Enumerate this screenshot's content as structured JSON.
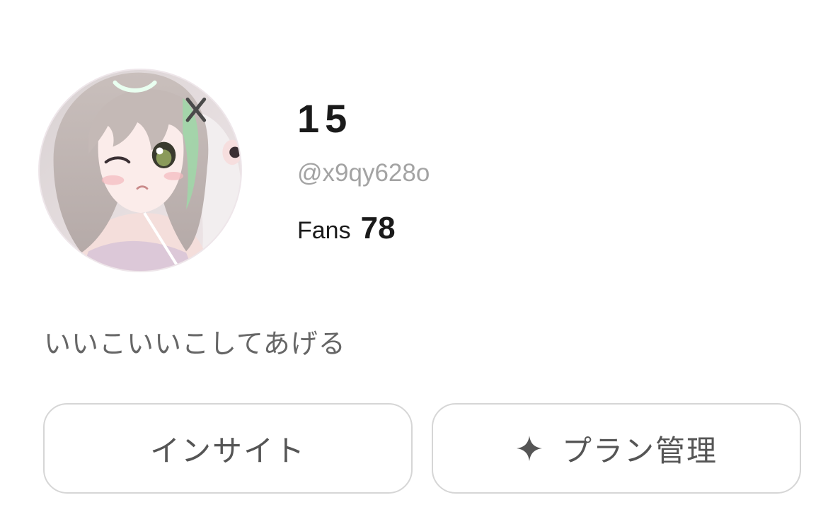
{
  "profile": {
    "display_name": "15",
    "handle": "@x9qy628o",
    "fans_label": "Fans",
    "fans_count": "78",
    "bio": "いいこいいこしてあげる"
  },
  "actions": {
    "insight_label": "インサイト",
    "plan_label": "プラン管理",
    "plan_icon": "sparkle-icon"
  },
  "colors": {
    "primary_text": "#1a1a1a",
    "secondary_text": "#a3a3a3",
    "bio_text": "#666666",
    "button_border": "#d6d6d6",
    "button_text": "#555555"
  }
}
